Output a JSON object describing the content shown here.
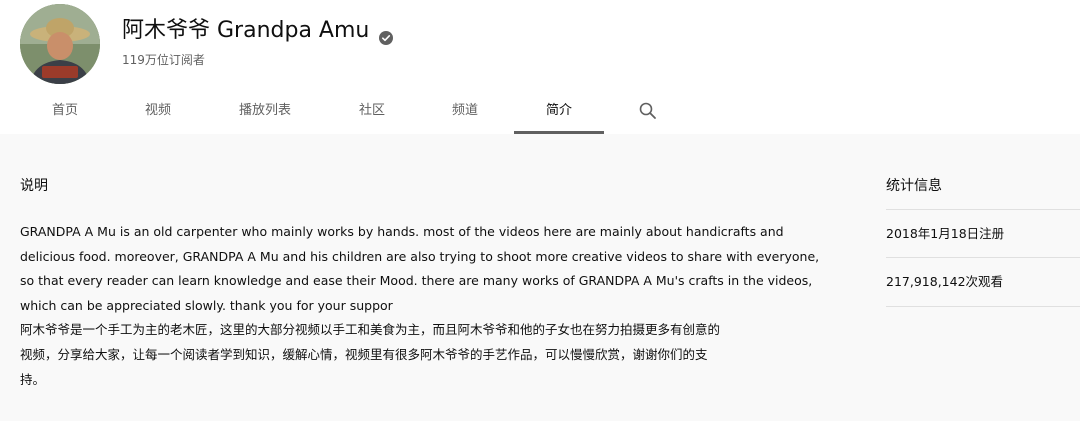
{
  "channel": {
    "name": "阿木爷爷 Grandpa Amu",
    "subscribers": "119万位订阅者"
  },
  "tabs": [
    {
      "label": "首页"
    },
    {
      "label": "视频"
    },
    {
      "label": "播放列表"
    },
    {
      "label": "社区"
    },
    {
      "label": "频道"
    },
    {
      "label": "简介",
      "active": true
    }
  ],
  "icons": {
    "search": "search-icon",
    "verified": "verified-check-icon"
  },
  "about": {
    "description_title": "说明",
    "description_lines": [
      "GRANDPA A Mu is an old carpenter who mainly works by hands. most of the videos here are mainly about handicrafts and",
      "delicious food. moreover, GRANDPA A Mu and his children are also trying to shoot more creative videos to share with everyone,",
      "so that every reader can learn knowledge and ease their Mood. there are many works of GRANDPA A Mu's crafts in the videos,",
      "which can be appreciated slowly. thank you for your suppor",
      "阿木爷爷是一个手工为主的老木匠，这里的大部分视频以手工和美食为主，而且阿木爷爷和他的子女也在努力拍摄更多有创意的",
      "视频，分享给大家，让每一个阅读者学到知识，缓解心情，视频里有很多阿木爷爷的手艺作品，可以慢慢欣赏，谢谢你们的支",
      "持。"
    ],
    "stats_title": "统计信息",
    "joined": "2018年1月18日注册",
    "views": "217,918,142次观看"
  },
  "colors": {
    "header_bg": "#ffffff",
    "content_bg": "#f9f9f9",
    "secondary_text": "#606060",
    "primary_text": "#0f0f0f"
  }
}
